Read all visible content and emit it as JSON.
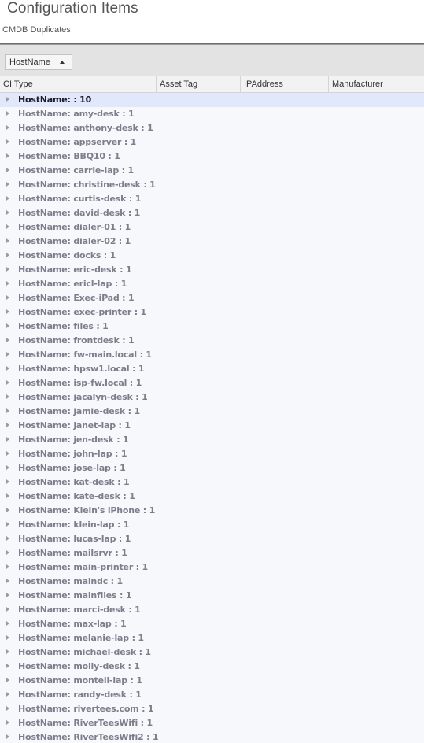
{
  "header": {
    "title": "Configuration Items",
    "subtitle": "CMDB Duplicates"
  },
  "group_panel": {
    "group_by_label": "HostName",
    "sort_direction": "ascending"
  },
  "columns": [
    {
      "label": "CI Type"
    },
    {
      "label": "Asset Tag"
    },
    {
      "label": "IPAddress"
    },
    {
      "label": "Manufacturer"
    }
  ],
  "groups": [
    {
      "text": "HostName: : 10",
      "selected": true
    },
    {
      "text": "HostName: amy-desk : 1"
    },
    {
      "text": "HostName: anthony-desk : 1"
    },
    {
      "text": "HostName: appserver : 1"
    },
    {
      "text": "HostName: BBQ10 : 1"
    },
    {
      "text": "HostName: carrie-lap : 1"
    },
    {
      "text": "HostName: christine-desk : 1"
    },
    {
      "text": "HostName: curtis-desk : 1"
    },
    {
      "text": "HostName: david-desk : 1"
    },
    {
      "text": "HostName: dialer-01 : 1"
    },
    {
      "text": "HostName: dialer-02 : 1"
    },
    {
      "text": "HostName: docks : 1"
    },
    {
      "text": "HostName: eric-desk : 1"
    },
    {
      "text": "HostName: ericl-lap : 1"
    },
    {
      "text": "HostName: Exec-iPad : 1"
    },
    {
      "text": "HostName: exec-printer : 1"
    },
    {
      "text": "HostName: files : 1"
    },
    {
      "text": "HostName: frontdesk : 1"
    },
    {
      "text": "HostName: fw-main.local : 1"
    },
    {
      "text": "HostName: hpsw1.local : 1"
    },
    {
      "text": "HostName: isp-fw.local : 1"
    },
    {
      "text": "HostName: jacalyn-desk : 1"
    },
    {
      "text": "HostName: jamie-desk : 1"
    },
    {
      "text": "HostName: janet-lap : 1"
    },
    {
      "text": "HostName: jen-desk : 1"
    },
    {
      "text": "HostName: john-lap : 1"
    },
    {
      "text": "HostName: jose-lap : 1"
    },
    {
      "text": "HostName: kat-desk : 1"
    },
    {
      "text": "HostName: kate-desk : 1"
    },
    {
      "text": "HostName: Klein's iPhone : 1"
    },
    {
      "text": "HostName: klein-lap : 1"
    },
    {
      "text": "HostName: lucas-lap : 1"
    },
    {
      "text": "HostName: mailsrvr : 1"
    },
    {
      "text": "HostName: main-printer : 1"
    },
    {
      "text": "HostName: maindc : 1"
    },
    {
      "text": "HostName: mainfiles : 1"
    },
    {
      "text": "HostName: marci-desk : 1"
    },
    {
      "text": "HostName: max-lap : 1"
    },
    {
      "text": "HostName: melanie-lap : 1"
    },
    {
      "text": "HostName: michael-desk : 1"
    },
    {
      "text": "HostName: molly-desk : 1"
    },
    {
      "text": "HostName: montell-lap : 1"
    },
    {
      "text": "HostName: randy-desk : 1"
    },
    {
      "text": "HostName: rivertees.com : 1"
    },
    {
      "text": "HostName: RiverTeesWifi : 1"
    },
    {
      "text": "HostName: RiverTeesWifi2 : 1"
    }
  ]
}
